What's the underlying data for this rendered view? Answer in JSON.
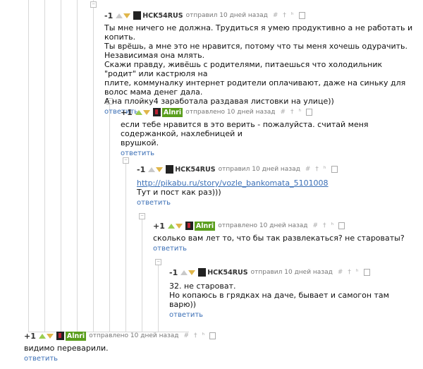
{
  "icons": {
    "hash": "#",
    "dagger": "†",
    "branch": "ʰ"
  },
  "reply_label": "ответить",
  "comments": [
    {
      "rating": "-1",
      "user": "HCK54RUS",
      "time": "отправил 10 дней назад",
      "lines": [
        "Ты мне ничего не должна. Трудиться я умею продуктивно а не работать и копить.",
        "Ты врёшь, а мне это не нравится, потому что ты меня хочешь одурачить.",
        "Независимая она млять.",
        "Скажи правду, живёшь с родителями, питаешься что холодильник \"родит\" или кастрюля на",
        "плите, коммуналку интернет родители оплачивают, даже на синьку для волос мама денег дала.",
        "А на плойку4 заработала раздавая листовки на улице))"
      ]
    },
    {
      "rating": "+1",
      "user": "Alnri",
      "time": "отправлено 10 дней назад",
      "lines": [
        "если тебе нравится в это верить - пожалуйста. считай меня содержанкой, нахлебницей и",
        "врушкой."
      ]
    },
    {
      "rating": "-1",
      "user": "HCK54RUS",
      "time": "отправил 10 дней назад",
      "link": "http://pikabu.ru/story/vozle_bankomata_5101008",
      "lines": [
        "Тут и пост как раз)))"
      ]
    },
    {
      "rating": "+1",
      "user": "Alnri",
      "time": "отправлено 10 дней назад",
      "lines": [
        "сколько вам лет то, что бы так развлекаться? не староваты?"
      ]
    },
    {
      "rating": "-1",
      "user": "HCK54RUS",
      "time": "отправил 10 дней назад",
      "lines": [
        "32. не староват.",
        "Но копаюсь в грядках на даче, бывает и самогон там варю))"
      ]
    },
    {
      "rating": "+1",
      "user": "Alnri",
      "time": "отправлено 10 дней назад",
      "lines": [
        "видимо переварили."
      ]
    }
  ]
}
